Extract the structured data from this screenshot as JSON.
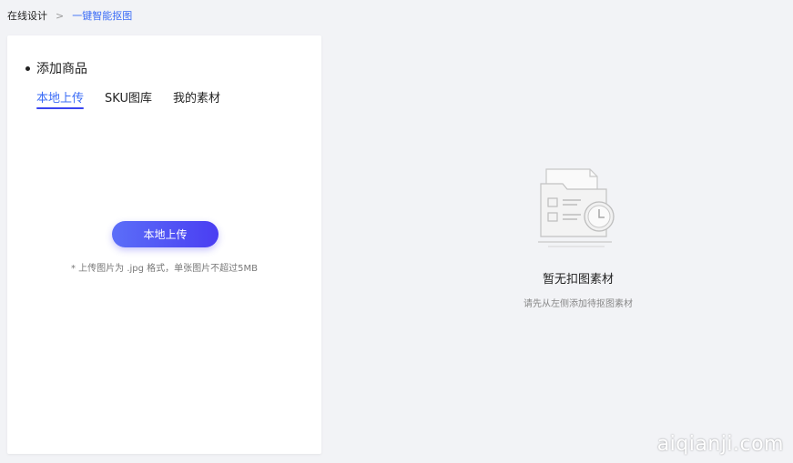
{
  "breadcrumb": {
    "root": "在线设计",
    "separator": ">",
    "current": "一键智能抠图"
  },
  "panel": {
    "section_title": "添加商品",
    "tabs": [
      {
        "label": "本地上传",
        "active": true
      },
      {
        "label": "SKU图库",
        "active": false
      },
      {
        "label": "我的素材",
        "active": false
      }
    ],
    "upload_button": "本地上传",
    "upload_hint": "* 上传图片为 .jpg 格式，单张图片不超过5MB"
  },
  "empty_state": {
    "icon": "folder-clock-icon",
    "title": "暂无扣图素材",
    "subtitle": "请先从左侧添加待抠图素材"
  },
  "watermark": "aiqianji.com",
  "colors": {
    "accent": "#3b6cf6",
    "button_gradient_start": "#5b6ef8",
    "button_gradient_end": "#4a3ef2",
    "background": "#f2f3f6"
  }
}
